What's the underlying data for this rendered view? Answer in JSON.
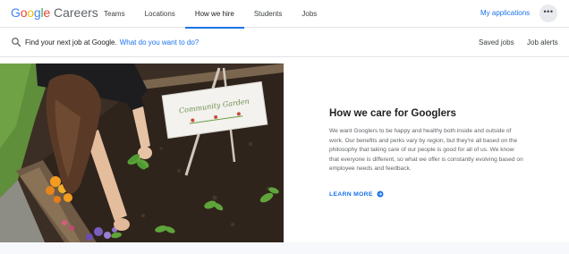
{
  "brand": {
    "logo_letters": [
      {
        "char": "G",
        "color": "#4285F4"
      },
      {
        "char": "o",
        "color": "#EA4335"
      },
      {
        "char": "o",
        "color": "#FBBC05"
      },
      {
        "char": "g",
        "color": "#4285F4"
      },
      {
        "char": "l",
        "color": "#34A853"
      },
      {
        "char": "e",
        "color": "#EA4335"
      }
    ],
    "product": "Careers"
  },
  "nav": {
    "items": [
      {
        "label": "Teams",
        "active": false
      },
      {
        "label": "Locations",
        "active": false
      },
      {
        "label": "How we hire",
        "active": true
      },
      {
        "label": "Students",
        "active": false
      },
      {
        "label": "Jobs",
        "active": false
      }
    ],
    "my_applications": "My applications",
    "more_icon": "more-horizontal-icon"
  },
  "search": {
    "prompt": "Find your next job at Google.",
    "prompt_link": "What do you want to do?",
    "icon": "search-icon",
    "saved_jobs": "Saved jobs",
    "job_alerts": "Job alerts"
  },
  "hero": {
    "title": "How we care for Googlers",
    "body": "We want Googlers to be happy and healthy both inside and outside of work. Our benefits and perks vary by region, but they're all based on the philosophy that taking care of our people is good for all of us. We know that everyone is different, so what we offer is constantly evolving based on employee needs and feedback.",
    "cta": "LEARN MORE",
    "cta_icon": "arrow-right-circle-icon",
    "photo_sign_text": "Community Garden"
  },
  "colors": {
    "accent": "#1a73e8",
    "text_primary": "#202124",
    "text_secondary": "#5f6368"
  }
}
